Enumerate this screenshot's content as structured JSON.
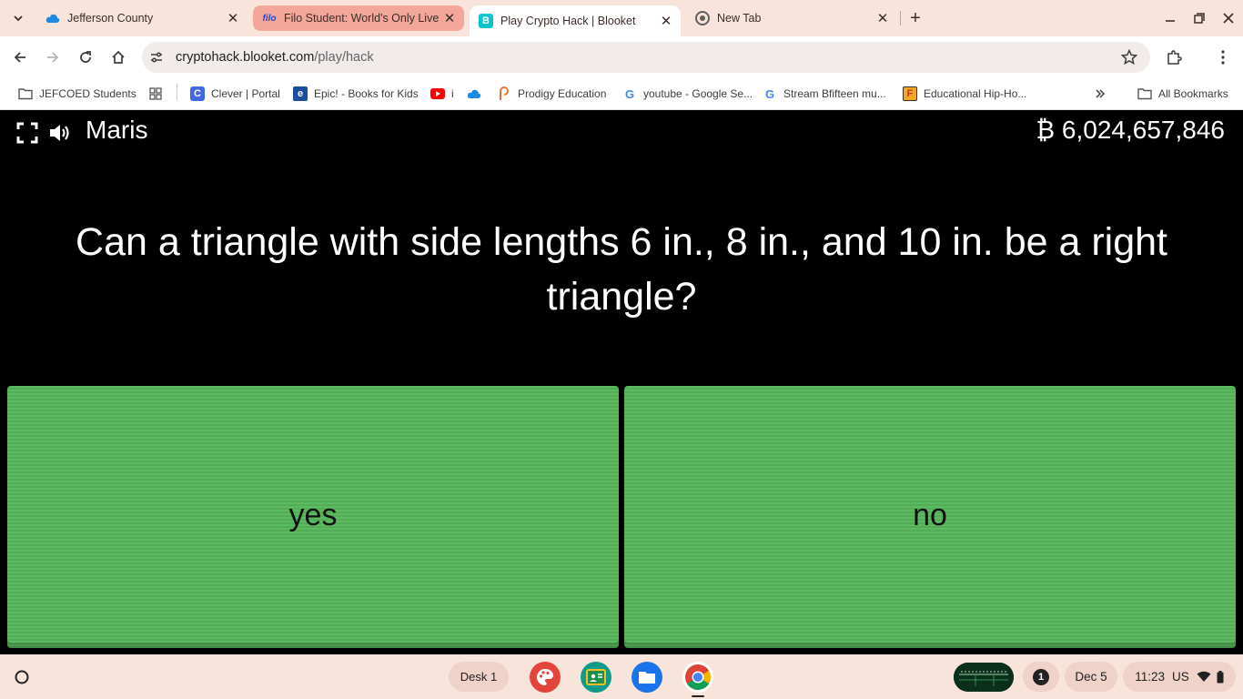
{
  "browser": {
    "tabs": [
      {
        "title": "Jefferson County",
        "icon": "onedrive-cloud-icon",
        "active": false
      },
      {
        "title": "Filo Student: World's Only Live",
        "icon": "filo-icon",
        "favicon_text": "filo",
        "active": false
      },
      {
        "title": "Play Crypto Hack | Blooket",
        "icon": "blooket-icon",
        "favicon_text": "B",
        "active": true
      },
      {
        "title": "New Tab",
        "icon": "chrome-icon",
        "active": false
      }
    ],
    "url": {
      "host": "cryptohack.blooket.com",
      "path": "/play/hack"
    },
    "bookmarks": [
      {
        "label": "JEFCOED Students",
        "icon": "folder-icon"
      },
      {
        "label": "",
        "icon": "apps-grid-icon"
      },
      {
        "label": "Clever | Portal",
        "icon": "clever-icon",
        "favicon_text": "C"
      },
      {
        "label": "Epic! - Books for Kids",
        "icon": "epic-icon",
        "favicon_text": "e"
      },
      {
        "label": "i",
        "icon": "youtube-icon"
      },
      {
        "label": "",
        "icon": "onedrive-cloud-icon"
      },
      {
        "label": "Prodigy Education",
        "icon": "prodigy-icon"
      },
      {
        "label": "youtube - Google Se...",
        "icon": "google-icon",
        "favicon_text": "G"
      },
      {
        "label": "Stream Bfifteen mu...",
        "icon": "google-icon",
        "favicon_text": "G"
      },
      {
        "label": "Educational Hip-Ho...",
        "icon": "flocabulary-icon",
        "favicon_text": "F"
      }
    ],
    "all_bookmarks_label": "All Bookmarks"
  },
  "game": {
    "player_name": "Maris",
    "balance": "₿ 6,024,657,846",
    "question": "Can a triangle with side lengths 6 in., 8 in., and 10 in. be a right triangle?",
    "answers": [
      "yes",
      "no"
    ],
    "answer_color": "#5cba60"
  },
  "shelf": {
    "desk_label": "Desk 1",
    "apps": [
      "canvas-paint-icon",
      "classroom-icon",
      "files-icon",
      "chrome-icon"
    ],
    "notification_count": "1",
    "date": "Dec 5",
    "time": "11:23",
    "locale": "US"
  },
  "colors": {
    "frame": "#f9e4dc",
    "active_tab": "#ffffff",
    "highlighted_tab": "#f2a79a",
    "game_background": "#000000"
  }
}
